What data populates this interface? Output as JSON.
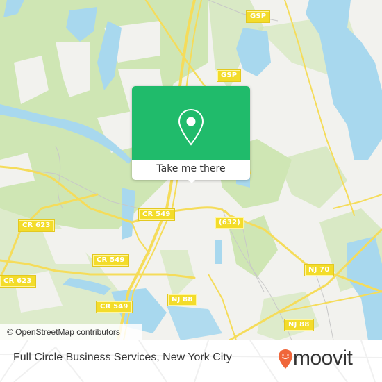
{
  "map": {
    "attribution": "© OpenStreetMap contributors",
    "road_labels": [
      {
        "id": "gsp-top",
        "text": "GSP"
      },
      {
        "id": "gsp-mid",
        "text": "GSP"
      },
      {
        "id": "cr549-a",
        "text": "CR 549"
      },
      {
        "id": "cr549-b",
        "text": "CR 549"
      },
      {
        "id": "cr549-c",
        "text": "CR 549"
      },
      {
        "id": "cr623-a",
        "text": "CR 623"
      },
      {
        "id": "cr623-b",
        "text": "CR 623"
      },
      {
        "id": "r632",
        "text": "(632)"
      },
      {
        "id": "nj70",
        "text": "NJ 70"
      },
      {
        "id": "nj88-a",
        "text": "NJ 88"
      },
      {
        "id": "nj88-b",
        "text": "NJ 88"
      }
    ],
    "colors": {
      "land": "#f2f2ee",
      "park": "#cfe6b4",
      "water": "#a8d8ee",
      "road": "#f5dc5a",
      "shield": "#f3dc2a"
    }
  },
  "popup": {
    "icon": "map-pin-icon",
    "action_label": "Take me there",
    "color": "#20bb6b"
  },
  "footer": {
    "place_name": "Full Circle Business Services, New York City",
    "brand": "moovit",
    "brand_color": "#f0663a"
  }
}
